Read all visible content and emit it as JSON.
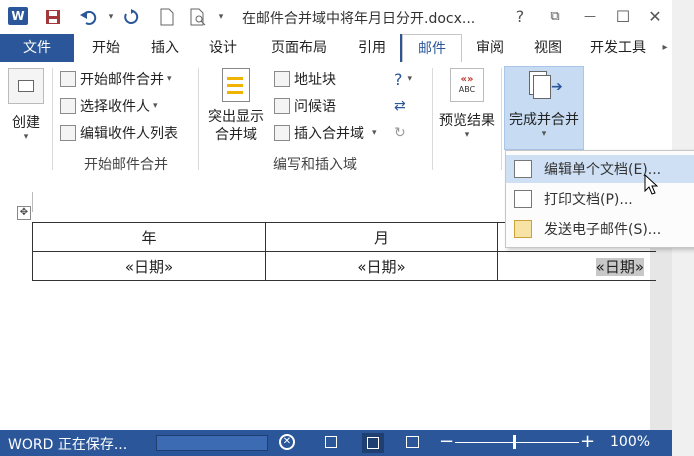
{
  "titlebar": {
    "app_icon": "W",
    "title": "在邮件合并域中将年月日分开.docx...",
    "help": "?",
    "restore": "⧉",
    "minimize": "—",
    "maximize": "☐",
    "close": "✕"
  },
  "tabs": [
    "文件",
    "开始",
    "插入",
    "设计",
    "页面布局",
    "引用",
    "邮件",
    "审阅",
    "视图",
    "开发工具"
  ],
  "active_tab": "邮件",
  "ribbon": {
    "create_label": "创建",
    "start_group": {
      "start_merge": "开始邮件合并",
      "select_recipients": "选择收件人",
      "edit_recipients": "编辑收件人列表",
      "label": "开始邮件合并"
    },
    "write_group": {
      "highlight_line1": "突出显示",
      "highlight_line2": "合并域",
      "address_block": "地址块",
      "greeting": "问候语",
      "insert_field": "插入合并域",
      "label": "编写和插入域"
    },
    "preview": {
      "label": "预览结果",
      "icon_text": "ABC"
    },
    "finish": {
      "label": "完成并合并"
    }
  },
  "menu": {
    "items": [
      "编辑单个文档(E)...",
      "打印文档(P)...",
      "发送电子邮件(S)..."
    ]
  },
  "table": {
    "headers": [
      "年",
      "月",
      ""
    ],
    "row": [
      "«日期»",
      "«日期»",
      "«日期»"
    ]
  },
  "statusbar": {
    "status": "WORD 正在保存...",
    "zoom": "100%"
  },
  "colors": {
    "accent": "#2b579a",
    "highlight": "#cfe0f5"
  }
}
